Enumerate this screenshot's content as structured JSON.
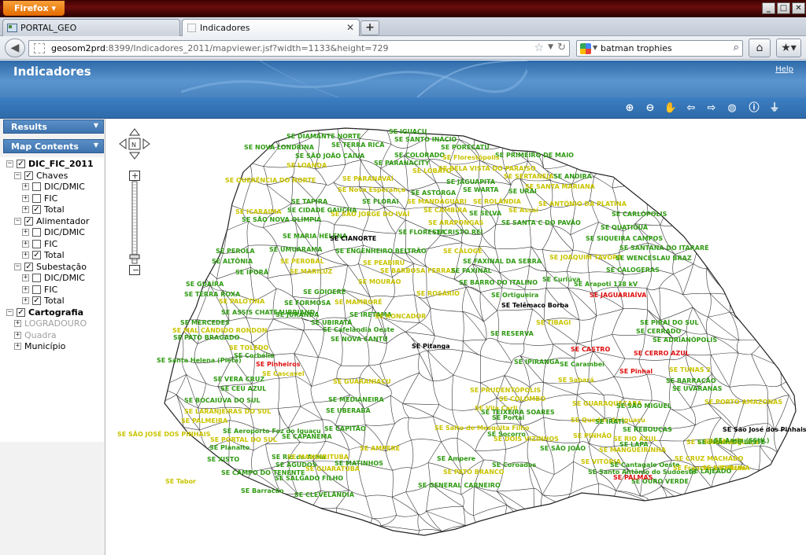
{
  "browser": {
    "app_button": "Firefox",
    "tabs": [
      {
        "label": "PORTAL_GEO",
        "active": false
      },
      {
        "label": "Indicadores",
        "active": true
      }
    ],
    "url_host": "geosom2prd",
    "url_rest": ":8399/Indicadores_2011/mapviewer.jsf?width=1133&height=729",
    "search_value": "batman trophies"
  },
  "app": {
    "title": "Indicadores",
    "help_label": "Help"
  },
  "sidebar": {
    "results_label": "Results",
    "map_contents_label": "Map Contents",
    "tree": [
      {
        "label": "DIC_FIC_2011",
        "level": 0,
        "checked": true,
        "bold": true
      },
      {
        "label": "Chaves",
        "level": 1,
        "checked": true
      },
      {
        "label": "DIC/DMIC",
        "level": 2,
        "checked": false
      },
      {
        "label": "FIC",
        "level": 2,
        "checked": false
      },
      {
        "label": "Total",
        "level": 2,
        "checked": true
      },
      {
        "label": "Alimentador",
        "level": 1,
        "checked": true
      },
      {
        "label": "DIC/DMIC",
        "level": 2,
        "checked": false
      },
      {
        "label": "FIC",
        "level": 2,
        "checked": false
      },
      {
        "label": "Total",
        "level": 2,
        "checked": true
      },
      {
        "label": "Subestação",
        "level": 1,
        "checked": true
      },
      {
        "label": "DIC/DMIC",
        "level": 2,
        "checked": false
      },
      {
        "label": "FIC",
        "level": 2,
        "checked": false
      },
      {
        "label": "Total",
        "level": 2,
        "checked": true
      },
      {
        "label": "Cartografia",
        "level": 0,
        "checked": true,
        "bold": true
      },
      {
        "label": "LOGRADOURO",
        "level": 1,
        "checked": null,
        "dim": true
      },
      {
        "label": "Quadra",
        "level": 1,
        "checked": null,
        "dim": true
      },
      {
        "label": "Município",
        "level": 1,
        "checked": null
      }
    ]
  },
  "map": {
    "labels": [
      {
        "t": "SE IGUAÇU",
        "c": "green"
      },
      {
        "t": "SE DIAMANTE NORTE",
        "c": "green"
      },
      {
        "t": "SE SANTO INÁCIO",
        "c": "green"
      },
      {
        "t": "SE NOVA LONDRINA",
        "c": "green"
      },
      {
        "t": "SE TERRA RICA",
        "c": "green"
      },
      {
        "t": "SE PORECATU",
        "c": "green"
      },
      {
        "t": "SE SÃO JOÃO CAIUA",
        "c": "green"
      },
      {
        "t": "SE COLORADO",
        "c": "green"
      },
      {
        "t": "SE PRIMEIRO DE MAIO",
        "c": "green"
      },
      {
        "t": "SE LOANDA",
        "c": "yellow"
      },
      {
        "t": "SE PARANACITY",
        "c": "green"
      },
      {
        "t": "SE Florestópolis",
        "c": "yellow"
      },
      {
        "t": "SE LOBATO",
        "c": "yellow"
      },
      {
        "t": "SE BELA VISTA DO PARAISO",
        "c": "yellow"
      },
      {
        "t": "SE ANDIRA",
        "c": "green"
      },
      {
        "t": "SE QUERÊNCIA DO NORTE",
        "c": "yellow"
      },
      {
        "t": "SE PARANAVAÍ",
        "c": "yellow"
      },
      {
        "t": "SE JAGUAPITA",
        "c": "green"
      },
      {
        "t": "SE SERTANEJA",
        "c": "yellow"
      },
      {
        "t": "SE SANTA MARIANA",
        "c": "yellow"
      },
      {
        "t": "SE Nova Esperança",
        "c": "yellow"
      },
      {
        "t": "SE ASTORGA",
        "c": "green"
      },
      {
        "t": "SE WARTA",
        "c": "green"
      },
      {
        "t": "SE URAI",
        "c": "green"
      },
      {
        "t": "SE TAPIRA",
        "c": "green"
      },
      {
        "t": "SE FLORAI",
        "c": "green"
      },
      {
        "t": "SE MANDAGUARI",
        "c": "yellow"
      },
      {
        "t": "SE ROLÂNDIA",
        "c": "yellow"
      },
      {
        "t": "SE ANTÔNIO DA PLATINA",
        "c": "yellow"
      },
      {
        "t": "SE ICARAIMA",
        "c": "yellow"
      },
      {
        "t": "SE CIDADE GAÚCHA",
        "c": "green"
      },
      {
        "t": "SE SÃO JORGE DO IVAÍ",
        "c": "yellow"
      },
      {
        "t": "SE CAMBIRA",
        "c": "yellow"
      },
      {
        "t": "SE SELVA",
        "c": "green"
      },
      {
        "t": "SE Assaí",
        "c": "yellow"
      },
      {
        "t": "SE CARLÓPOLIS",
        "c": "green"
      },
      {
        "t": "SE SÃO NOVA OLÍMPIA",
        "c": "green"
      },
      {
        "t": "SE ARAPONGAS",
        "c": "yellow"
      },
      {
        "t": "SE SANTA C DO PAVÃO",
        "c": "green"
      },
      {
        "t": "SE QUATIGUÁ",
        "c": "green"
      },
      {
        "t": "SE MARIA HELENA",
        "c": "green"
      },
      {
        "t": "SE CIANORTE",
        "c": "black"
      },
      {
        "t": "SE FLORESTA",
        "c": "green"
      },
      {
        "t": "SE CRISTO REI",
        "c": "green"
      },
      {
        "t": "SE SIQUEIRA CAMPOS",
        "c": "green"
      },
      {
        "t": "SE PEROLA",
        "c": "green"
      },
      {
        "t": "SE UMUARAMA",
        "c": "green"
      },
      {
        "t": "SE ENGENHEIRO BELTRÃO",
        "c": "green"
      },
      {
        "t": "SE CALOGÊ",
        "c": "yellow"
      },
      {
        "t": "SE SANTANA DO ITARARÉ",
        "c": "green"
      },
      {
        "t": "SE ALTÔNIA",
        "c": "green"
      },
      {
        "t": "SE PEROBAL",
        "c": "yellow"
      },
      {
        "t": "SE PEABIRU",
        "c": "yellow"
      },
      {
        "t": "SE FAXINAL DA SERRA",
        "c": "green"
      },
      {
        "t": "SE JOAQUIM TAVORA",
        "c": "yellow"
      },
      {
        "t": "SE WENCESLAU BRAZ",
        "c": "green"
      },
      {
        "t": "SE IPORÃ",
        "c": "green"
      },
      {
        "t": "SE MARILUZ",
        "c": "yellow"
      },
      {
        "t": "SE BARBOSA FERRAZ",
        "c": "yellow"
      },
      {
        "t": "SE FAXINAL",
        "c": "green"
      },
      {
        "t": "SE CALOGERAS",
        "c": "green"
      },
      {
        "t": "SE GUAÍRA",
        "c": "green"
      },
      {
        "t": "SE MOURAO",
        "c": "yellow"
      },
      {
        "t": "SE BARRO DO ITALINO",
        "c": "green"
      },
      {
        "t": "SE Curiúva",
        "c": "green"
      },
      {
        "t": "SE TERRA ROXA",
        "c": "green"
      },
      {
        "t": "SE GOIOERÊ",
        "c": "green"
      },
      {
        "t": "SE ROSÁRIO",
        "c": "yellow"
      },
      {
        "t": "SE Ortigueira",
        "c": "green"
      },
      {
        "t": "SE Arapoti 138 kV",
        "c": "green"
      },
      {
        "t": "SE PALOTINA",
        "c": "yellow"
      },
      {
        "t": "SE FORMOSA",
        "c": "green"
      },
      {
        "t": "SE MAMBORÊ",
        "c": "yellow"
      },
      {
        "t": "SE Telêmaco Borba",
        "c": "black"
      },
      {
        "t": "SE JAGUARIAÍVA",
        "c": "red"
      },
      {
        "t": "SE ASSIS CHATEAUBRIAND",
        "c": "green"
      },
      {
        "t": "SE JURANDA",
        "c": "green"
      },
      {
        "t": "SE IRETAMA",
        "c": "green"
      },
      {
        "t": "SE MERCEDES",
        "c": "green"
      },
      {
        "t": "SE UBIRATÃ",
        "c": "green"
      },
      {
        "t": "SE RONCADOR",
        "c": "yellow"
      },
      {
        "t": "SE TIBAGI",
        "c": "yellow"
      },
      {
        "t": "SE PIRAÍ DO SUL",
        "c": "green"
      },
      {
        "t": "SE MAL CÂNDIDO RONDON",
        "c": "yellow"
      },
      {
        "t": "SE Cafelândia Oeste",
        "c": "green"
      },
      {
        "t": "SE RESERVA",
        "c": "green"
      },
      {
        "t": "SE CERRADO",
        "c": "green"
      },
      {
        "t": "SE PATO BRAGADO",
        "c": "green"
      },
      {
        "t": "SE NOVA CANTU",
        "c": "green"
      },
      {
        "t": "SE ADRIANÓPOLIS",
        "c": "green"
      },
      {
        "t": "SE TOLEDO",
        "c": "yellow"
      },
      {
        "t": "SE Pitanga",
        "c": "black"
      },
      {
        "t": "SE Corbélia",
        "c": "green"
      },
      {
        "t": "SE CASTRO",
        "c": "red"
      },
      {
        "t": "SE CERRO AZUL",
        "c": "red"
      },
      {
        "t": "SE Santa Helena (Pietá)",
        "c": "green"
      },
      {
        "t": "SE Pinheiros",
        "c": "red"
      },
      {
        "t": "SE Carambeí",
        "c": "green"
      },
      {
        "t": "SE Cascavel",
        "c": "yellow"
      },
      {
        "t": "SE IPIRANGA",
        "c": "green"
      },
      {
        "t": "SE Pinhal",
        "c": "red"
      },
      {
        "t": "SE TUNAS 2",
        "c": "yellow"
      },
      {
        "t": "SE VERA CRUZ",
        "c": "green"
      },
      {
        "t": "SE GUARANIAÇU",
        "c": "yellow"
      },
      {
        "t": "SE Sabará",
        "c": "yellow"
      },
      {
        "t": "SE BARRACÃO",
        "c": "green"
      },
      {
        "t": "SE CEU AZUL",
        "c": "green"
      },
      {
        "t": "SE PRUDENTÓPOLIS",
        "c": "yellow"
      },
      {
        "t": "SE UVARANAS",
        "c": "green"
      },
      {
        "t": "SE BOCAIÚVA DO SUL",
        "c": "green"
      },
      {
        "t": "SE MEDIANEIRA",
        "c": "green"
      },
      {
        "t": "SE COLOMBO",
        "c": "yellow"
      },
      {
        "t": "SE GUARAQUEÇABA",
        "c": "yellow"
      },
      {
        "t": "SE SÃO MIGUEL",
        "c": "green"
      },
      {
        "t": "SE LARANJEIRAS DO SUL",
        "c": "yellow"
      },
      {
        "t": "SE Vila Carli",
        "c": "yellow"
      },
      {
        "t": "SE TEIXEIRA SOARES",
        "c": "green"
      },
      {
        "t": "SE PALMEIRA",
        "c": "yellow"
      },
      {
        "t": "SE UBERABA",
        "c": "green"
      },
      {
        "t": "SE Portal",
        "c": "green"
      },
      {
        "t": "SE Quedas do Iguaçu",
        "c": "yellow"
      },
      {
        "t": "SE IRATI",
        "c": "green"
      },
      {
        "t": "SE PORTO AMAZONAS",
        "c": "yellow"
      },
      {
        "t": "SE SÃO JOSÉ DOS PINHAIS",
        "c": "yellow"
      },
      {
        "t": "SE Aeroporto Foz do Iguaçu",
        "c": "green"
      },
      {
        "t": "SE CAPITÃO",
        "c": "green"
      },
      {
        "t": "SE Salto de Mesquita Filho",
        "c": "yellow"
      },
      {
        "t": "SE Socorro",
        "c": "green"
      },
      {
        "t": "SE REBOUÇAS",
        "c": "green"
      },
      {
        "t": "SE São José dos Pinhais",
        "c": "black"
      },
      {
        "t": "SE PORTAL DO SUL",
        "c": "yellow"
      },
      {
        "t": "SE CAPANEMA",
        "c": "green"
      },
      {
        "t": "SE DOIS VIZINHOS",
        "c": "yellow"
      },
      {
        "t": "SE PINHÃO",
        "c": "yellow"
      },
      {
        "t": "SE RIO AZUL",
        "c": "yellow"
      },
      {
        "t": "SE LAPA",
        "c": "green"
      },
      {
        "t": "SE Cachoeira Iguaçu",
        "c": "yellow"
      },
      {
        "t": "SE PRAIA DE LESTE",
        "c": "green"
      },
      {
        "t": "SE Planalto",
        "c": "green"
      },
      {
        "t": "SE AMPERE",
        "c": "yellow"
      },
      {
        "t": "SE SÃO JOÃO",
        "c": "green"
      },
      {
        "t": "SE MANGUEIRINHA",
        "c": "yellow"
      },
      {
        "t": "SE MALLET",
        "c": "yellow"
      },
      {
        "t": "SE XISTO",
        "c": "green"
      },
      {
        "t": "SE Rio da Areia",
        "c": "green"
      },
      {
        "t": "SE MANDIRITUBA",
        "c": "yellow"
      },
      {
        "t": "SE MATINHOS",
        "c": "green"
      },
      {
        "t": "SE Ampere",
        "c": "green"
      },
      {
        "t": "SE VITÓRIA",
        "c": "yellow"
      },
      {
        "t": "SE Cantagalo Oeste",
        "c": "green"
      },
      {
        "t": "SE Areia (SSUL)",
        "c": "green"
      },
      {
        "t": "SE CRUZ MACHADO",
        "c": "yellow"
      },
      {
        "t": "SE CAMPO DO TENENTE",
        "c": "green"
      },
      {
        "t": "SE AGUDOS",
        "c": "green"
      },
      {
        "t": "SE GUARATUBA",
        "c": "yellow"
      },
      {
        "t": "SE Coroados",
        "c": "green"
      },
      {
        "t": "SE Santo Antônio do Sudoeste",
        "c": "green"
      },
      {
        "t": "SE Francisco Beltrão",
        "c": "yellow"
      },
      {
        "t": "SE BITURUNA",
        "c": "yellow"
      },
      {
        "t": "SE Tabor",
        "c": "yellow"
      },
      {
        "t": "SE SALGADO FILHO",
        "c": "green"
      },
      {
        "t": "SE PATO BRANCO",
        "c": "yellow"
      },
      {
        "t": "SE OURO VERDE",
        "c": "green"
      },
      {
        "t": "SE LAJEADO",
        "c": "green"
      },
      {
        "t": "SE Barracão",
        "c": "green"
      },
      {
        "t": "SE CLEVELÂNDIA",
        "c": "green"
      },
      {
        "t": "SE GENERAL CARNEIRO",
        "c": "green"
      },
      {
        "t": "SE PALMAS",
        "c": "red"
      }
    ]
  }
}
